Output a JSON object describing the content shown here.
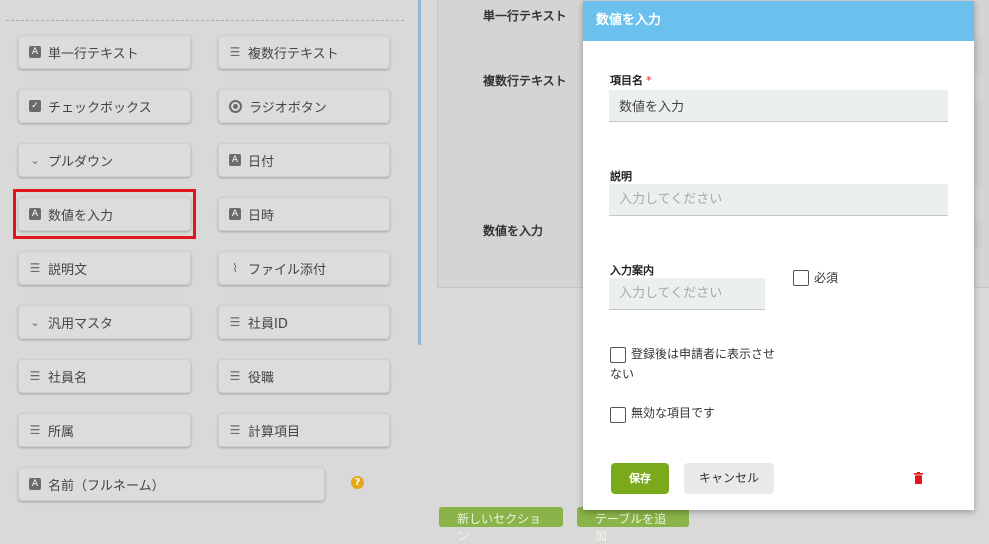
{
  "palette": {
    "buttons": [
      {
        "label": "単一行テキスト",
        "icon": "text-field-icon"
      },
      {
        "label": "複数行テキスト",
        "icon": "lines-icon"
      },
      {
        "label": "チェックボックス",
        "icon": "checkbox-icon"
      },
      {
        "label": "ラジオボタン",
        "icon": "radio-icon"
      },
      {
        "label": "プルダウン",
        "icon": "chevron-down-icon"
      },
      {
        "label": "日付",
        "icon": "text-field-icon"
      },
      {
        "label": "数値を入力",
        "icon": "text-field-icon"
      },
      {
        "label": "日時",
        "icon": "text-field-icon"
      },
      {
        "label": "説明文",
        "icon": "lines-icon"
      },
      {
        "label": "ファイル添付",
        "icon": "paperclip-icon"
      },
      {
        "label": "汎用マスタ",
        "icon": "chevron-down-icon"
      },
      {
        "label": "社員ID",
        "icon": "lines-icon"
      },
      {
        "label": "社員名",
        "icon": "lines-icon"
      },
      {
        "label": "役職",
        "icon": "lines-icon"
      },
      {
        "label": "所属",
        "icon": "lines-icon"
      },
      {
        "label": "計算項目",
        "icon": "lines-icon"
      },
      {
        "label": "名前（フルネーム）",
        "icon": "text-field-icon"
      }
    ],
    "help_glyph": "?"
  },
  "preview": {
    "labels": [
      "単一行テキスト",
      "複数行テキスト",
      "数値を入力"
    ],
    "bottom_buttons": [
      "新しいセクション",
      "テーブルを追加"
    ]
  },
  "modal": {
    "title": "数値を入力",
    "item_name_label": "項目名",
    "required_mark": "*",
    "item_name_value": "数値を入力",
    "description_label": "説明",
    "description_placeholder": "入力してください",
    "guide_label": "入力案内",
    "guide_placeholder": "入力してください",
    "required_checkbox_label": "必須",
    "hide_after_register_label": "登録後は申請者に表示させない",
    "invalid_item_label": "無効な項目です",
    "save_label": "保存",
    "cancel_label": "キャンセル"
  },
  "colors": {
    "modal_header": "#6bc1ed",
    "save_button": "#7aaa1c",
    "highlight": "#e3141b",
    "trash": "#e3141b"
  }
}
